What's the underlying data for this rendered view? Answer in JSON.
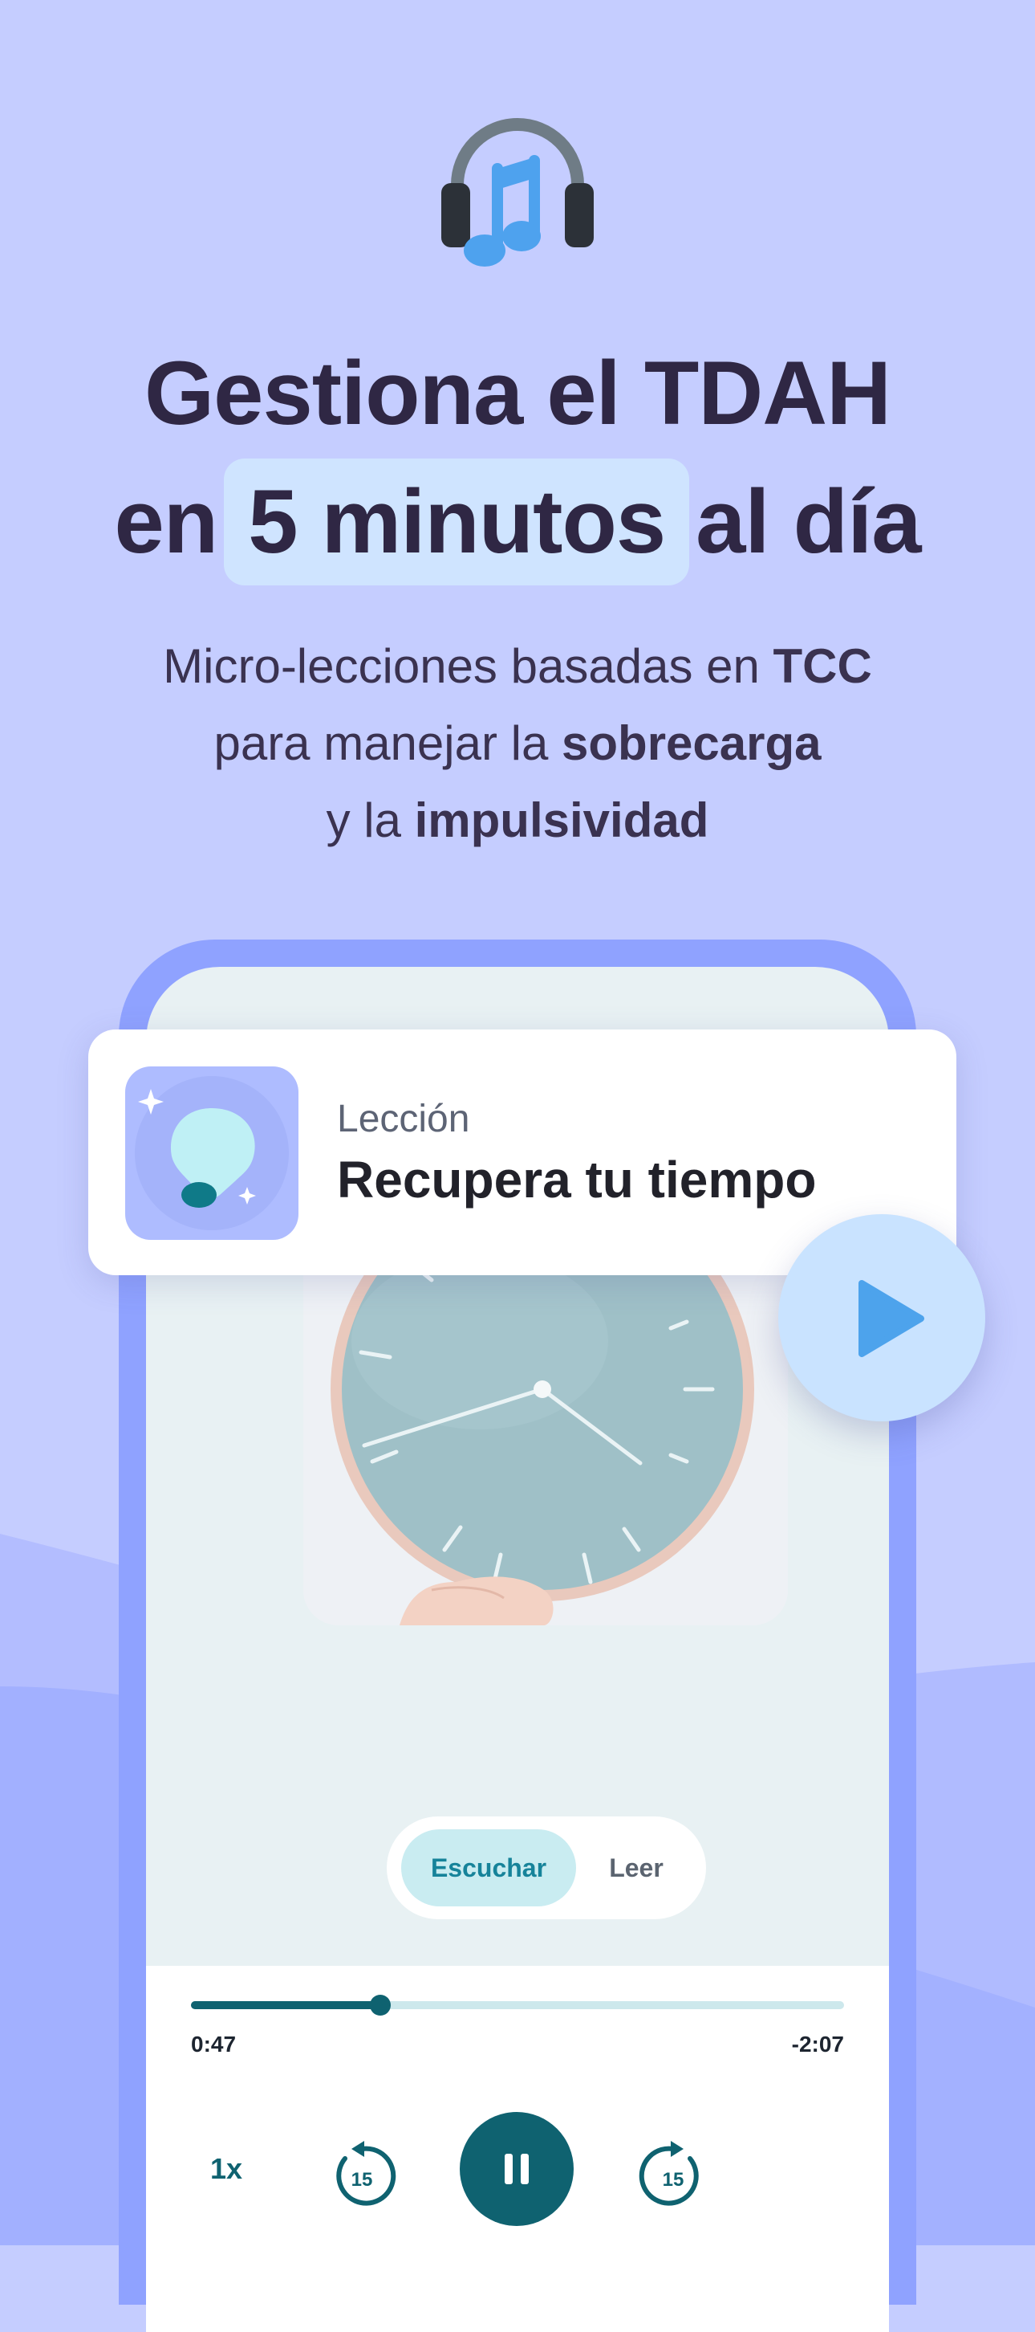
{
  "header": {
    "headline_line1": "Gestiona el TDAH",
    "headline_pre": "en",
    "headline_highlight": "5 minutos",
    "headline_post": "al día",
    "sub_line1_text": "Micro-lecciones basadas en",
    "sub_line1_bold": "TCC",
    "sub_line2_text": "para manejar la",
    "sub_line2_bold": "sobrecarga",
    "sub_line3_text": "y la",
    "sub_line3_bold": "impulsividad"
  },
  "lesson": {
    "eyebrow": "Lección",
    "title": "Recupera tu tiempo"
  },
  "mode_toggle": {
    "options": [
      "Escuchar",
      "Leer"
    ],
    "selected": "Escuchar"
  },
  "player": {
    "elapsed": "0:47",
    "remaining": "-2:07",
    "progress": 0.29,
    "speed": "1x",
    "skip_back_seconds": "15",
    "skip_forward_seconds": "15",
    "state": "playing"
  },
  "icons": {
    "header": "headphones-music-icon",
    "lesson": "lightbulb-icon",
    "play": "play-icon",
    "pause": "pause-icon",
    "skip_back": "rewind-15-icon",
    "skip_forward": "forward-15-icon"
  },
  "colors": {
    "background": "#c5cdff",
    "headline": "#2f2744",
    "highlight": "#cfe4ff",
    "accent_teal": "#0f6270",
    "toggle_active_bg": "#c9ecf1",
    "toggle_active_text": "#16839a",
    "phone_frame": "#8fa2ff",
    "play_button": "#c9e3ff",
    "play_icon": "#4da3ec"
  }
}
